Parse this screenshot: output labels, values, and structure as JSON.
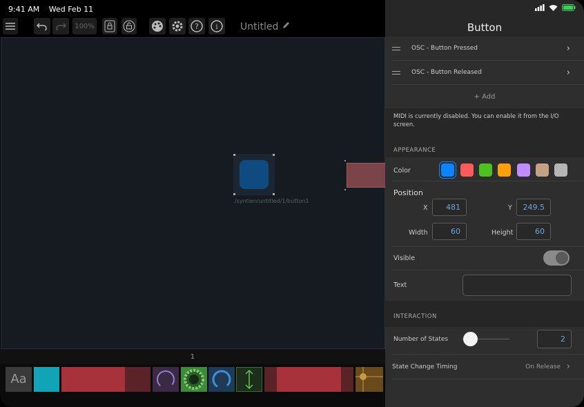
{
  "status": {
    "time": "9:41 AM",
    "date": "Wed Feb 11"
  },
  "toolbar": {
    "zoom": "100%",
    "doc_title": "Untitled"
  },
  "canvas": {
    "button_path": "/syntien/untitled/1/button1"
  },
  "page": {
    "number": "1"
  },
  "palette": {
    "text_item": "Aa"
  },
  "panel": {
    "title": "Button",
    "osc_rows": [
      {
        "label": "OSC -  Button Pressed"
      },
      {
        "label": "OSC -  Button Released"
      }
    ],
    "add_label": "+ Add",
    "midi_note": "MIDI is currently disabled. You can enable it from the I/O screen.",
    "appearance_label": "APPEARANCE",
    "color_label": "Color",
    "colors": [
      "#0a84ff",
      "#ff5b5b",
      "#4cc11f",
      "#ff9f0a",
      "#c08cff",
      "#c4a184",
      "#b5b5b5"
    ],
    "position_label": "Position",
    "x_label": "X",
    "x_value": "481",
    "y_label": "Y",
    "y_value": "249.5",
    "width_label": "Width",
    "width_value": "60",
    "height_label": "Height",
    "height_value": "60",
    "visible_label": "Visible",
    "visible_on": true,
    "text_label": "Text",
    "text_value": "",
    "interaction_label": "INTERACTION",
    "states_label": "Number of States",
    "states_value": "2",
    "timing_label": "State Change Timing",
    "timing_value": "On Release"
  }
}
